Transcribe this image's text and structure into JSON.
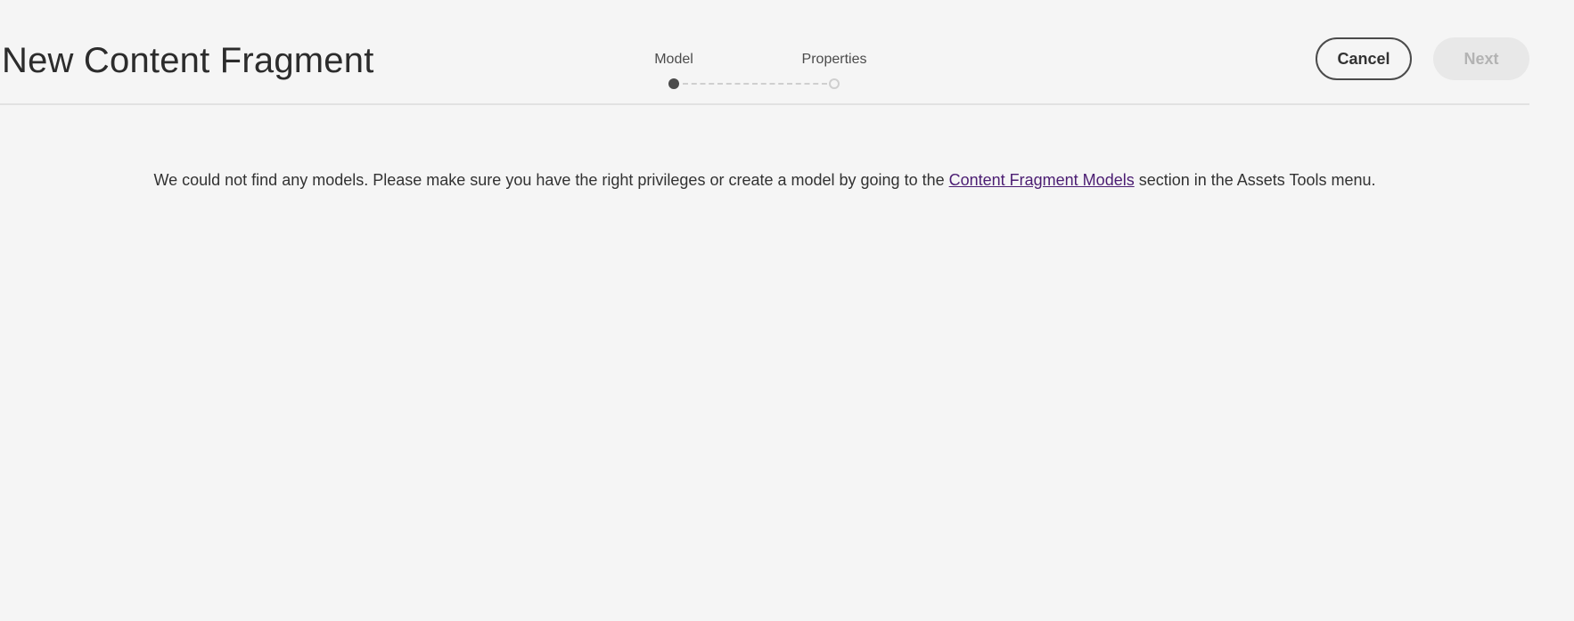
{
  "header": {
    "title": "New Content Fragment",
    "steps": [
      {
        "label": "Model",
        "state": "active"
      },
      {
        "label": "Properties",
        "state": "inactive"
      }
    ],
    "cancel_label": "Cancel",
    "next_label": "Next"
  },
  "message": {
    "text_before": "We could not find any models. Please make sure you have the right privileges or create a model by going to the ",
    "link_text": "Content Fragment Models",
    "text_after": " section in the Assets Tools menu."
  },
  "colors": {
    "background": "#f5f5f5",
    "link": "#4b1d72",
    "next_disabled_bg": "#e8e8e8"
  }
}
